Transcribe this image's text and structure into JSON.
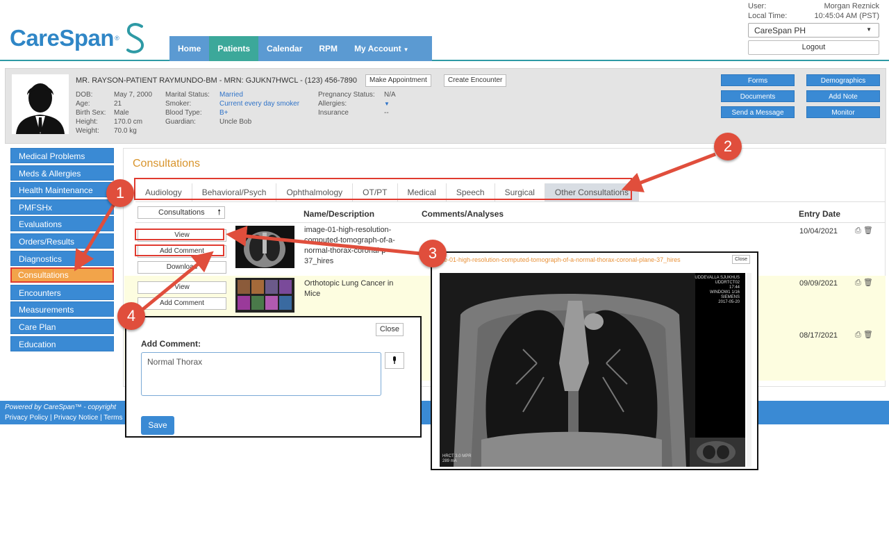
{
  "header": {
    "brand": "CareSpan",
    "brand_tm": "®",
    "nav": [
      "Home",
      "Patients",
      "Calendar",
      "RPM",
      "My Account"
    ],
    "active_nav": "Patients",
    "user_label": "User:",
    "user_name": "Morgan Reznick",
    "time_label": "Local Time:",
    "time_value": "10:45:04 AM (PST)",
    "org_select": "CareSpan PH",
    "logout": "Logout"
  },
  "patient": {
    "name_line": "MR. RAYSON-PATIENT RAYMUNDO-BM - MRN: GJUKN7HWCL - (123) 456-7890",
    "make_appointment": "Make Appointment",
    "create_encounter": "Create Encounter",
    "col1": {
      "labels": [
        "DOB:",
        "Age:",
        "Birth Sex:",
        "Height:",
        "Weight:"
      ],
      "values": [
        "May 7, 2000",
        "21",
        "Male",
        "170.0 cm",
        "70.0 kg"
      ]
    },
    "col2": {
      "labels": [
        "Marital Status:",
        "Smoker:",
        "Blood Type:",
        "Guardian:"
      ],
      "values": [
        "Married",
        "Current every day smoker",
        "B+",
        "Uncle Bob"
      ]
    },
    "col3": {
      "labels": [
        "Pregnancy Status:",
        "Allergies:",
        "Insurance"
      ],
      "values": [
        "N/A",
        "",
        "--"
      ]
    },
    "actions": [
      "Forms",
      "Demographics",
      "Documents",
      "Add Note",
      "Send a Message",
      "Monitor"
    ]
  },
  "sidebar": [
    "Medical Problems",
    "Meds & Allergies",
    "Health Maintenance",
    "PMFSHx",
    "Evaluations",
    "Orders/Results",
    "Diagnostics",
    "Consultations",
    "Encounters",
    "Measurements",
    "Care Plan",
    "Education"
  ],
  "sidebar_active": "Consultations",
  "main": {
    "title": "Consultations",
    "tabs": [
      "Audiology",
      "Behavioral/Psych",
      "Ophthalmology",
      "OT/PT",
      "Medical",
      "Speech",
      "Surgical",
      "Other Consultations"
    ],
    "active_tab": "Other Consultations",
    "sort_label": "Consultations",
    "columns": [
      "Name/Description",
      "Comments/Analyses",
      "Entry Date"
    ],
    "rows": [
      {
        "view": "View",
        "add_comment": "Add Comment",
        "download": "Download",
        "desc": "image-01-high-resolution-computed-tomograph-of-a-normal-thorax-coronal-p 37_hires",
        "date": "10/04/2021"
      },
      {
        "view": "View",
        "add_comment": "Add Comment",
        "desc": "Orthotopic Lung Cancer in Mice",
        "date": "09/09/2021"
      },
      {
        "date": "08/17/2021"
      }
    ]
  },
  "footer": {
    "powered": "Powered by CareSpan™ - copyright",
    "links": "Privacy Policy | Privacy Notice | Terms"
  },
  "modal": {
    "close": "Close",
    "label": "Add Comment:",
    "value": "Normal Thorax",
    "save": "Save"
  },
  "viewer": {
    "title": "ge-01-high-resolution-computed-tomograph-of-a-normal-thorax-coronal-plane-37_hires",
    "close": "Close",
    "overlay_tr": [
      "UDDEVALLA SJUKHUS",
      "UDDRTCT02",
      "17:44",
      "WINDOW1 1/16",
      "SIEMENS",
      "2017-05-20"
    ],
    "overlay_bl": [
      "HRCT 3.0 MPR",
      "289 mA"
    ]
  },
  "callouts": [
    "1",
    "2",
    "3",
    "4"
  ],
  "colors": {
    "nav": "#5b9ad2",
    "nav_active": "#3ca89a",
    "sidebar": "#3a8ad4",
    "sidebar_active": "#f2a44a",
    "callout": "#e04e3c",
    "title": "#d8942c"
  }
}
